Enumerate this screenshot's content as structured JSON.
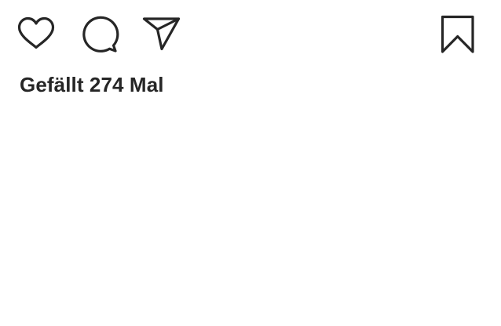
{
  "post_actions": {
    "icons": {
      "like": "heart-icon",
      "comment": "comment-bubble-icon",
      "share": "paper-plane-icon",
      "save": "bookmark-icon"
    },
    "icon_color": "#262626"
  },
  "likes": {
    "text": "Gefällt 274 Mal"
  }
}
